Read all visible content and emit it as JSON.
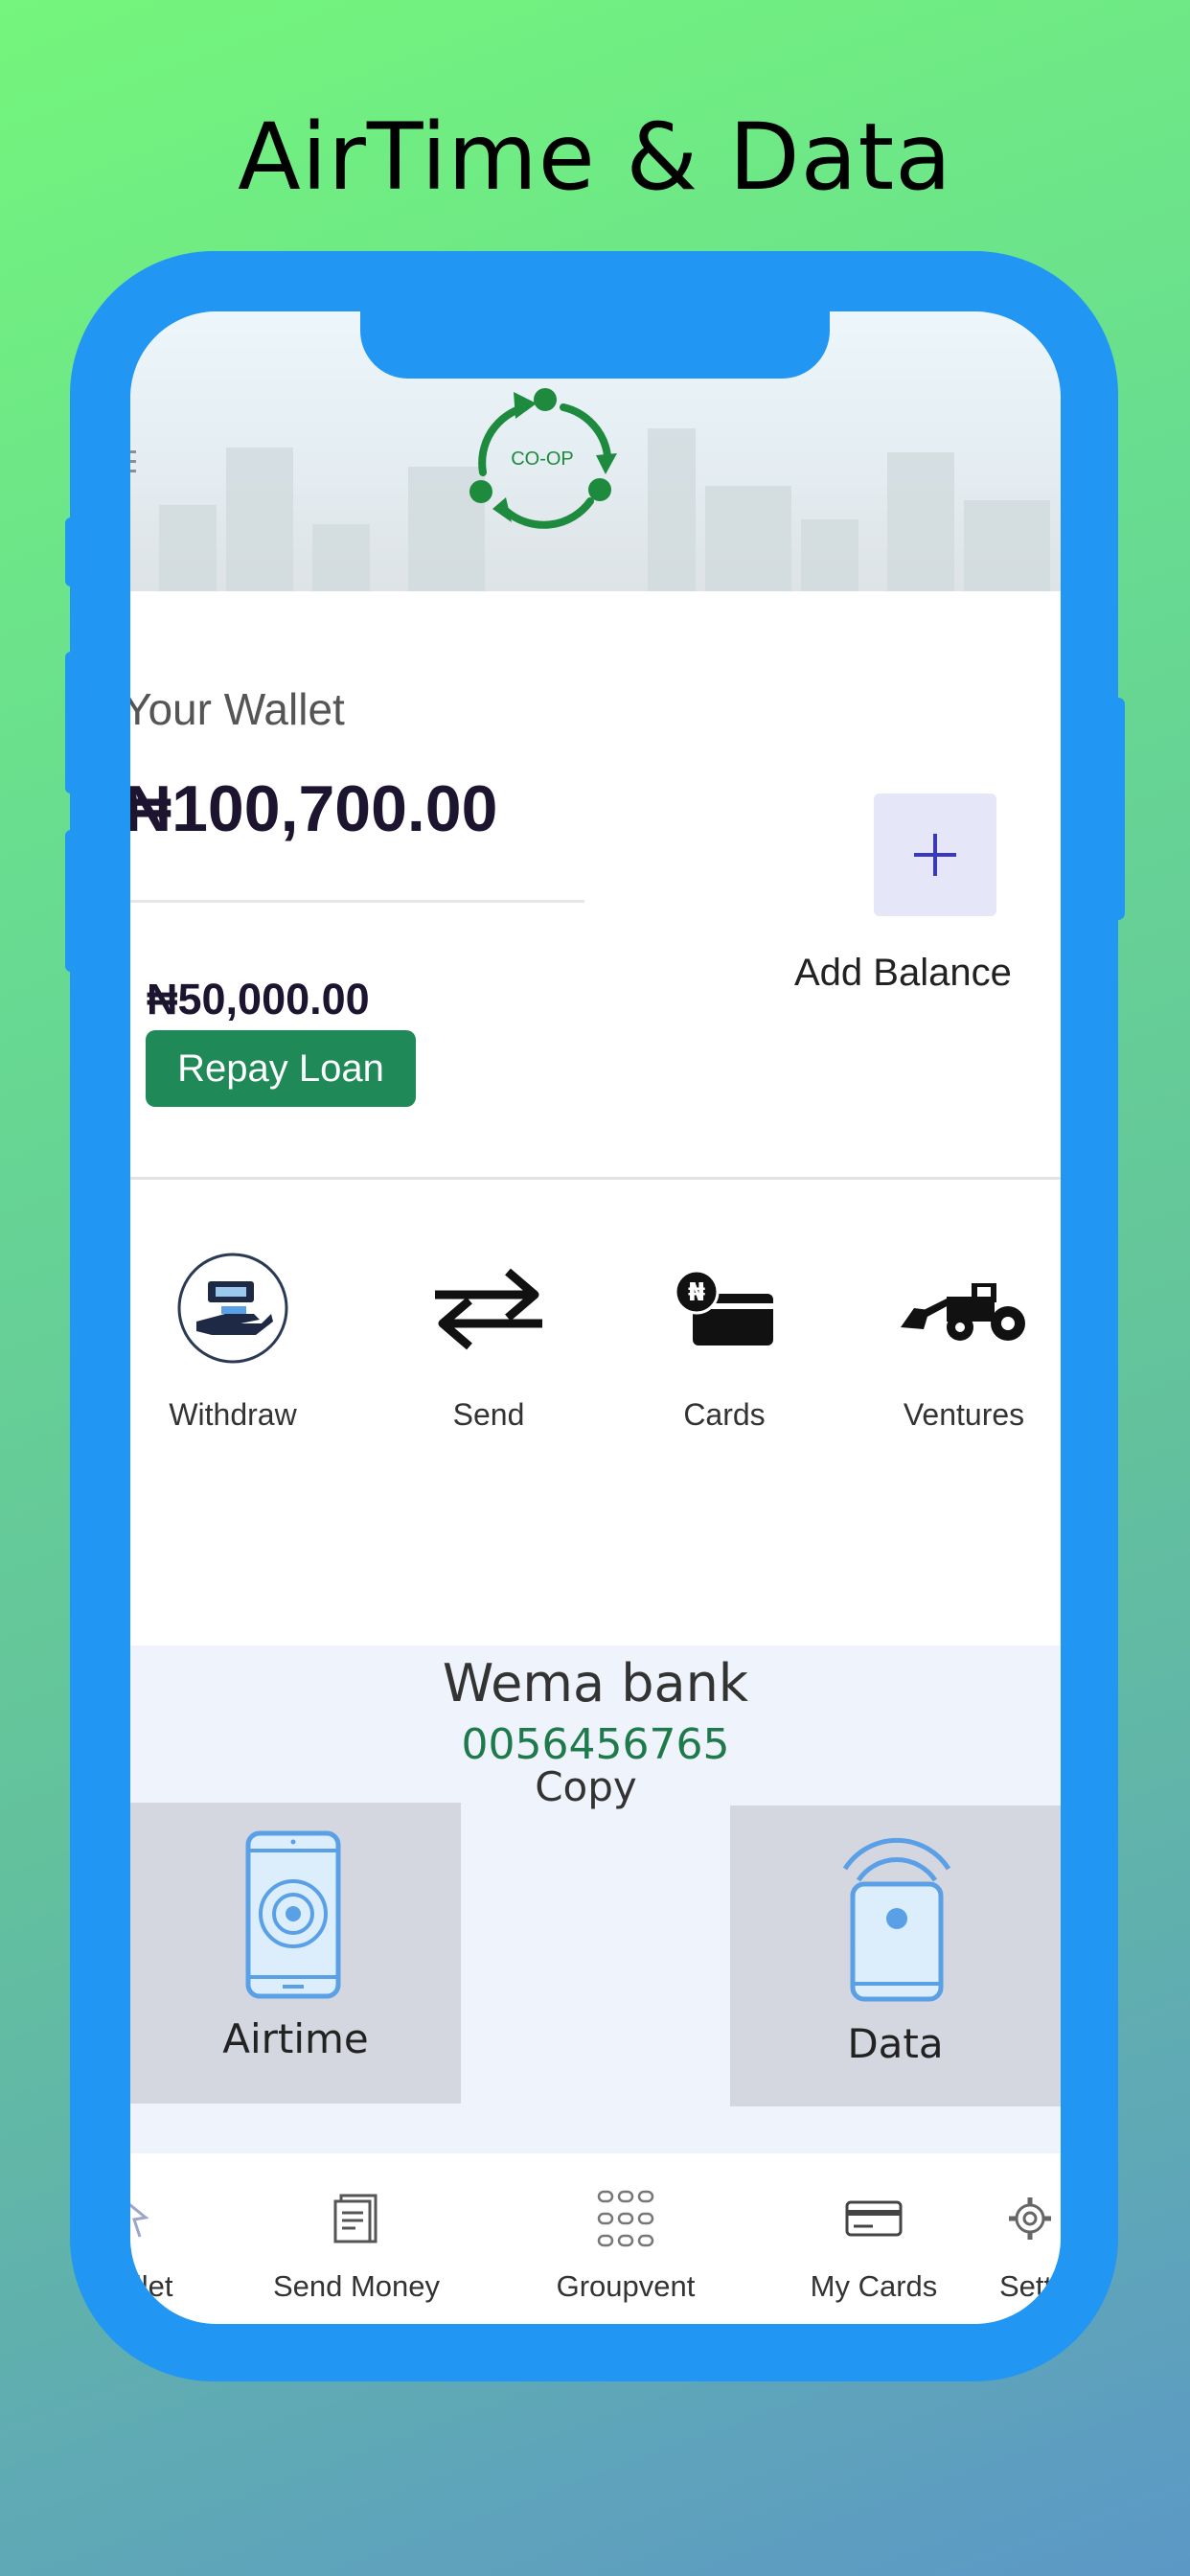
{
  "headline": "AirTime & Data",
  "logo_text": "CO-OP",
  "wallet": {
    "title": "Your Wallet",
    "balance": "₦100,700.00",
    "add_balance_label": "Add Balance",
    "loan_amount": "₦50,000.00",
    "repay_label": "Repay Loan"
  },
  "actions": [
    {
      "label": "Withdraw",
      "icon": "hand-cash-icon"
    },
    {
      "label": "Send",
      "icon": "transfer-arrows-icon"
    },
    {
      "label": "Cards",
      "icon": "naira-card-icon"
    },
    {
      "label": "Ventures",
      "icon": "tractor-icon"
    }
  ],
  "bank": {
    "name": "Wema bank",
    "account_number": "0056456765",
    "copy_label": "Copy"
  },
  "tiles": [
    {
      "label": "Airtime",
      "icon": "phone-target-icon"
    },
    {
      "label": "Data",
      "icon": "phone-signal-icon"
    }
  ],
  "bottom_nav": [
    {
      "label": "Wallet",
      "icon": "wallet-icon"
    },
    {
      "label": "Send Money",
      "icon": "receipt-icon"
    },
    {
      "label": "Groupvent",
      "icon": "grid-dots-icon"
    },
    {
      "label": "My Cards",
      "icon": "credit-card-icon"
    },
    {
      "label": "Settings",
      "icon": "gear-icon"
    }
  ],
  "colors": {
    "frame": "#2196f3",
    "accent_green": "#1f8a57",
    "account_green": "#1e7a4a",
    "tile_grey": "#d4d7df",
    "icon_blue": "#5aa0e6"
  }
}
